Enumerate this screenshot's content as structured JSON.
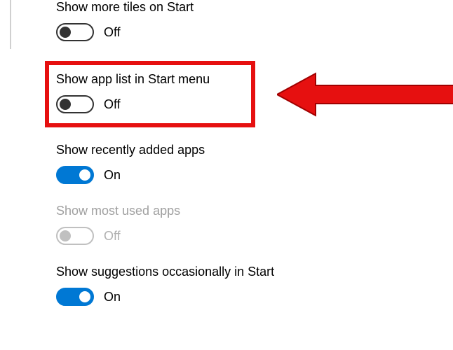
{
  "settings": {
    "items": [
      {
        "label": "Show more tiles on Start",
        "state": "Off",
        "on": false,
        "disabled": false,
        "highlighted": false
      },
      {
        "label": "Show app list in Start menu",
        "state": "Off",
        "on": false,
        "disabled": false,
        "highlighted": true
      },
      {
        "label": "Show recently added apps",
        "state": "On",
        "on": true,
        "disabled": false,
        "highlighted": false
      },
      {
        "label": "Show most used apps",
        "state": "Off",
        "on": false,
        "disabled": true,
        "highlighted": false
      },
      {
        "label": "Show suggestions occasionally in Start",
        "state": "On",
        "on": true,
        "disabled": false,
        "highlighted": false
      }
    ]
  },
  "annotation": {
    "arrow_color": "#e61010",
    "highlight_color": "#e61010"
  }
}
